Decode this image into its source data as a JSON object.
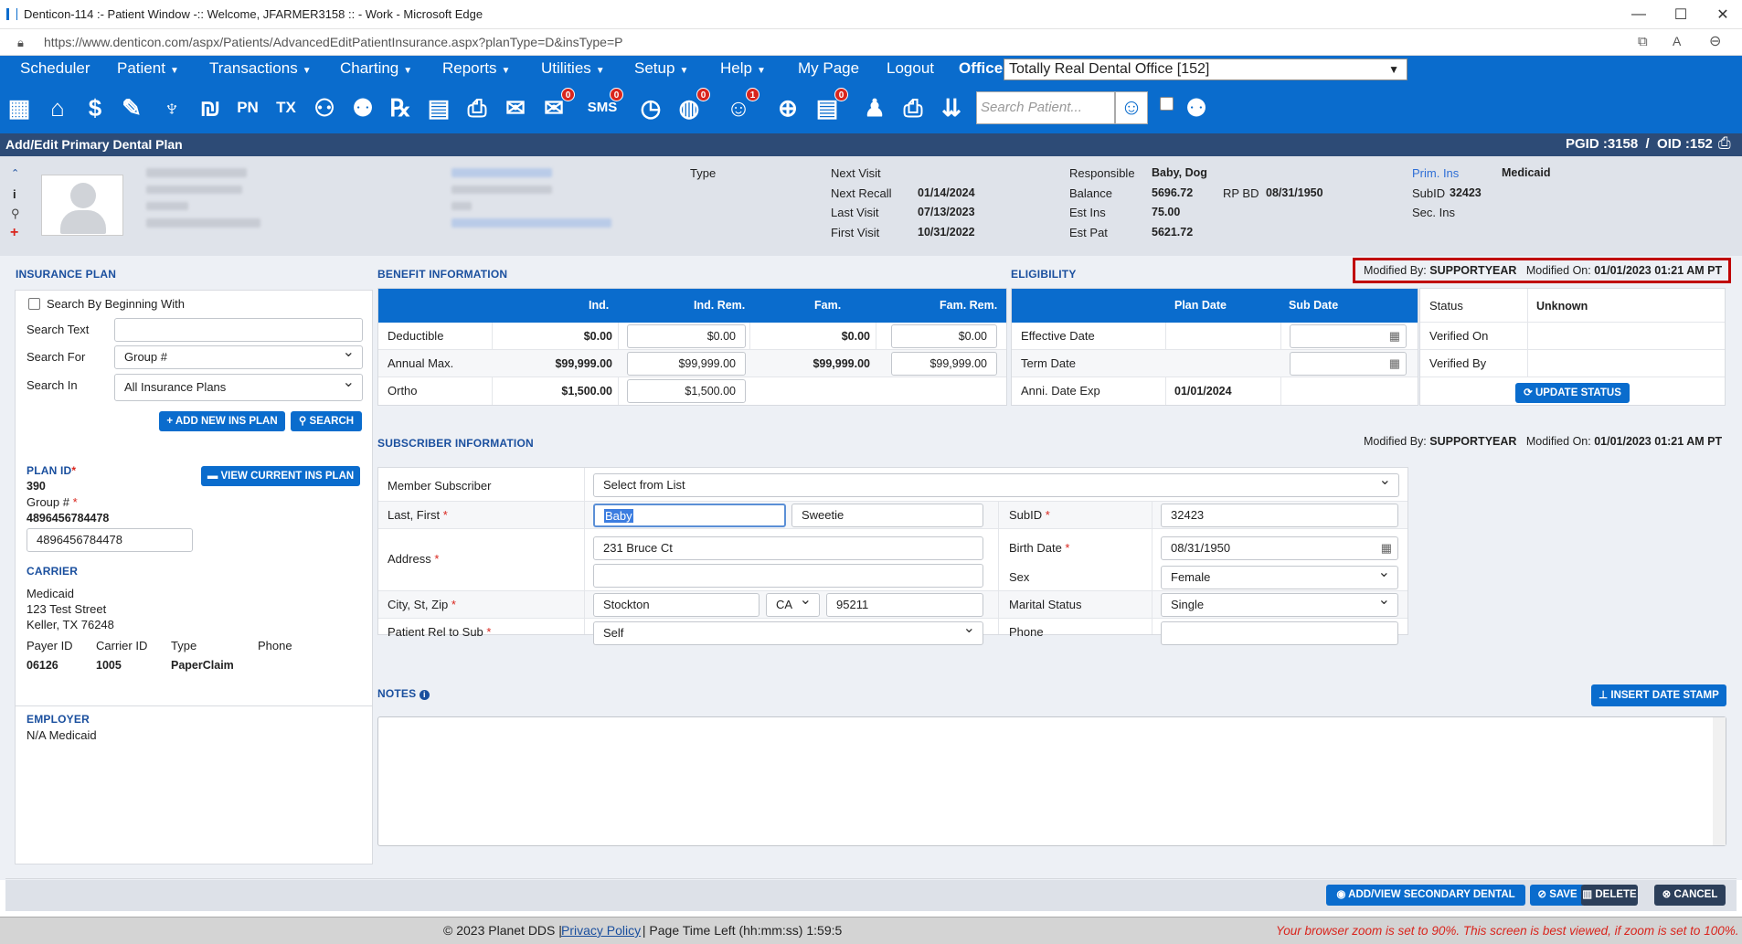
{
  "window": {
    "title": "Denticon-114 :- Patient Window -:: Welcome, JFARMER3158 :: - Work - Microsoft Edge",
    "url": "https://www.denticon.com/aspx/Patients/AdvancedEditPatientInsurance.aspx?planType=D&insType=P"
  },
  "menu": {
    "items": [
      "Scheduler",
      "Patient",
      "Transactions",
      "Charting",
      "Reports",
      "Utilities",
      "Setup",
      "Help",
      "My Page",
      "Logout"
    ],
    "office_label": "Office",
    "office_value": "Totally Real Dental Office [152]"
  },
  "toolbar": {
    "search_placeholder": "Search Patient...",
    "badge_zero": "0",
    "badge_one": "1",
    "sms_label": "SMS",
    "pn_label": "PN",
    "tx_label": "TX"
  },
  "header": {
    "title": "Add/Edit Primary Dental Plan",
    "pgid": "PGID :3158  /  OID :152"
  },
  "patient": {
    "type_label": "Type",
    "next_visit_label": "Next Visit",
    "next_recall_label": "Next Recall",
    "next_recall": "01/14/2024",
    "last_visit_label": "Last Visit",
    "last_visit": "07/13/2023",
    "first_visit_label": "First Visit",
    "first_visit": "10/31/2022",
    "responsible_label": "Responsible",
    "responsible": "Baby, Dog",
    "balance_label": "Balance",
    "balance": "5696.72",
    "rp_bd_label": "RP BD",
    "rp_bd": "08/31/1950",
    "est_ins_label": "Est Ins",
    "est_ins": "75.00",
    "est_pat_label": "Est Pat",
    "est_pat": "5621.72",
    "prim_ins_label": "Prim. Ins",
    "prim_ins": "Medicaid",
    "subid_label": "SubID",
    "subid": "32423",
    "sec_ins_label": "Sec. Ins"
  },
  "insurance_plan": {
    "section": "INSURANCE PLAN",
    "search_beginning": "Search By Beginning With",
    "search_text_label": "Search Text",
    "search_for_label": "Search For",
    "search_for_value": "Group #",
    "search_in_label": "Search In",
    "search_in_value": "All Insurance Plans",
    "add_new_btn": "+ ADD NEW INS PLAN",
    "search_btn": "SEARCH",
    "plan_id_label": "PLAN ID",
    "plan_id": "390",
    "view_current_btn": "VIEW CURRENT INS PLAN",
    "group_label": "Group #",
    "group_value": "4896456784478",
    "group_input": "4896456784478",
    "carrier_section": "CARRIER",
    "carrier_name": "Medicaid",
    "carrier_addr1": "123 Test Street",
    "carrier_addr2": "Keller, TX 76248",
    "payer_id_label": "Payer ID",
    "payer_id": "06126",
    "carrier_id_label": "Carrier ID",
    "carrier_id": "1005",
    "type_label": "Type",
    "type": "PaperClaim",
    "phone_label": "Phone",
    "employer_section": "EMPLOYER",
    "employer": "N/A Medicaid"
  },
  "benefit": {
    "section": "BENEFIT INFORMATION",
    "headers": [
      "Ind.",
      "Ind. Rem.",
      "Fam.",
      "Fam. Rem."
    ],
    "rows": [
      {
        "label": "Deductible",
        "ind": "$0.00",
        "ind_rem": "$0.00",
        "fam": "$0.00",
        "fam_rem": "$0.00"
      },
      {
        "label": "Annual Max.",
        "ind": "$99,999.00",
        "ind_rem": "$99,999.00",
        "fam": "$99,999.00",
        "fam_rem": "$99,999.00"
      },
      {
        "label": "Ortho",
        "ind": "$1,500.00",
        "ind_rem": "$1,500.00",
        "fam": "",
        "fam_rem": ""
      }
    ]
  },
  "eligibility": {
    "section": "ELIGIBILITY",
    "modified_by_label": "Modified By:",
    "modified_by": "SUPPORTYEAR",
    "modified_on_label": "Modified On:",
    "modified_on": "01/01/2023 01:21 AM PT",
    "headers": [
      "Plan Date",
      "Sub Date"
    ],
    "effective_label": "Effective Date",
    "term_label": "Term Date",
    "anni_label": "Anni. Date Exp",
    "anni_value": "01/01/2024",
    "status_label": "Status",
    "status_value": "Unknown",
    "verified_on_label": "Verified On",
    "verified_by_label": "Verified By",
    "update_btn": "UPDATE STATUS"
  },
  "subscriber": {
    "section": "SUBSCRIBER INFORMATION",
    "modified_by_label": "Modified By:",
    "modified_by": "SUPPORTYEAR",
    "modified_on_label": "Modified On:",
    "modified_on": "01/01/2023 01:21 AM PT",
    "member_label": "Member Subscriber",
    "member_value": "Select from List",
    "last_first_label": "Last, First",
    "last": "Baby",
    "first": "Sweetie",
    "subid_label": "SubID",
    "subid": "32423",
    "address_label": "Address",
    "address1": "231 Bruce Ct",
    "address2": "",
    "birth_label": "Birth Date",
    "birth": "08/31/1950",
    "sex_label": "Sex",
    "sex": "Female",
    "city_label": "City, St, Zip",
    "city": "Stockton",
    "state": "CA",
    "zip": "95211",
    "marital_label": "Marital Status",
    "marital": "Single",
    "rel_label": "Patient Rel to Sub",
    "rel": "Self",
    "phone_label": "Phone",
    "phone": ""
  },
  "notes": {
    "section": "NOTES",
    "insert_btn": "INSERT DATE STAMP"
  },
  "actions": {
    "secondary_btn": "ADD/VIEW SECONDARY DENTAL",
    "save_btn": "SAVE",
    "delete_btn": "DELETE",
    "cancel_btn": "CANCEL"
  },
  "footer": {
    "copyright": "© 2023 Planet DDS | ",
    "privacy": "Privacy Policy",
    "page_time": " | Page Time Left (hh:mm:ss) 1:59:5",
    "zoom_warning": "Your browser zoom is set to 90%. This screen is best viewed, if zoom is set to 100%."
  },
  "colors": {
    "menu_blue": "#0a6ccd",
    "header_navy": "#2d4b76",
    "highlight_red": "#c00000"
  }
}
